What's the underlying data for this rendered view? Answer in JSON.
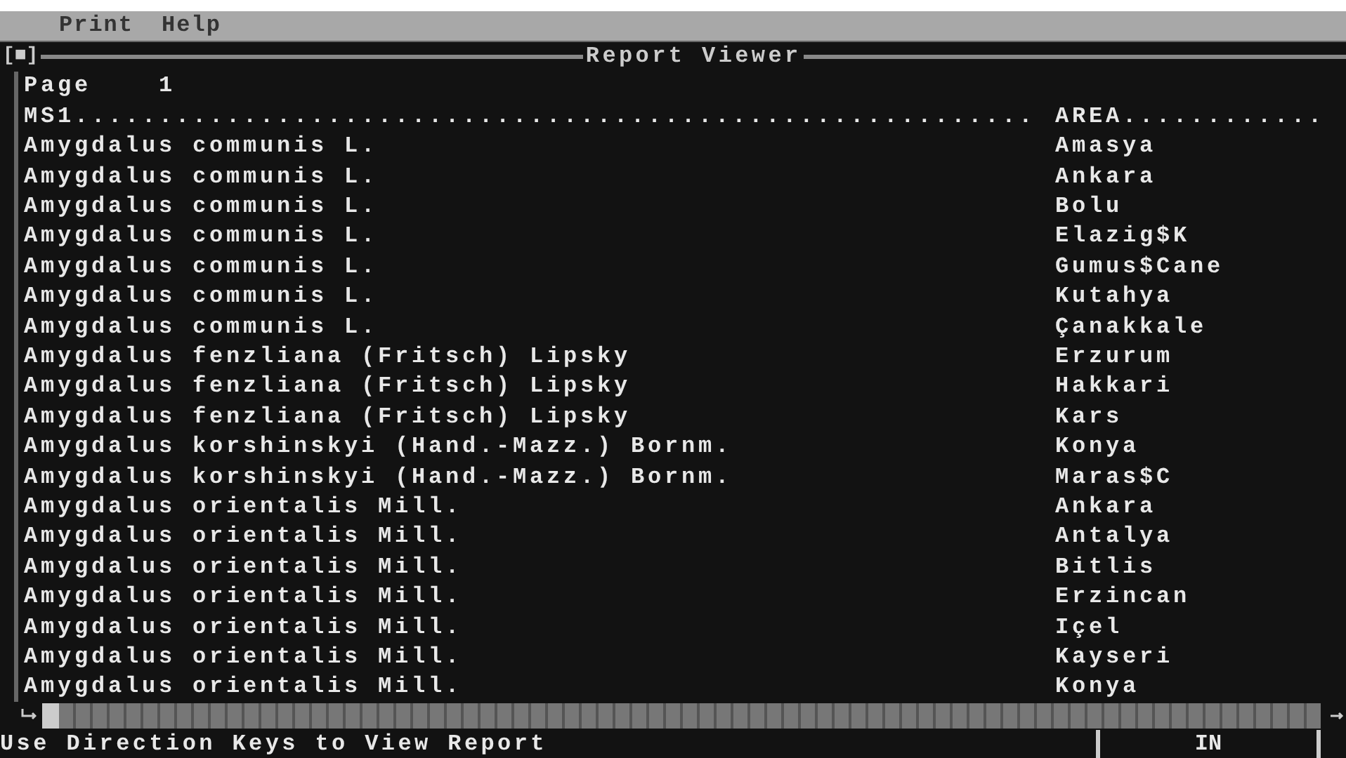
{
  "menu": [
    "Print",
    "Help"
  ],
  "window": {
    "close_glyph": "[■]",
    "title": "Report Viewer"
  },
  "page": {
    "label": "Page",
    "number": "1"
  },
  "header": {
    "column_1": "MS1.........................................................",
    "column_2": "AREA............"
  },
  "rows": [
    {
      "name": "Amygdalus communis L.",
      "area": "Amasya"
    },
    {
      "name": "Amygdalus communis L.",
      "area": "Ankara"
    },
    {
      "name": "Amygdalus communis L.",
      "area": "Bolu"
    },
    {
      "name": "Amygdalus communis L.",
      "area": "Elazig$K"
    },
    {
      "name": "Amygdalus communis L.",
      "area": "Gumus$Cane"
    },
    {
      "name": "Amygdalus communis L.",
      "area": "Kutahya"
    },
    {
      "name": "Amygdalus communis L.",
      "area": "Çanakkale"
    },
    {
      "name": "Amygdalus fenzliana (Fritsch) Lipsky",
      "area": "Erzurum"
    },
    {
      "name": "Amygdalus fenzliana (Fritsch) Lipsky",
      "area": "Hakkari"
    },
    {
      "name": "Amygdalus fenzliana (Fritsch) Lipsky",
      "area": "Kars"
    },
    {
      "name": "Amygdalus korshinskyi (Hand.-Mazz.) Bornm.",
      "area": "Konya"
    },
    {
      "name": "Amygdalus korshinskyi (Hand.-Mazz.) Bornm.",
      "area": "Maras$C"
    },
    {
      "name": "Amygdalus orientalis Mill.",
      "area": "Ankara"
    },
    {
      "name": "Amygdalus orientalis Mill.",
      "area": "Antalya"
    },
    {
      "name": "Amygdalus orientalis Mill.",
      "area": "Bitlis"
    },
    {
      "name": "Amygdalus orientalis Mill.",
      "area": "Erzincan"
    },
    {
      "name": "Amygdalus orientalis Mill.",
      "area": "Içel"
    },
    {
      "name": "Amygdalus orientalis Mill.",
      "area": "Kayseri"
    },
    {
      "name": "Amygdalus orientalis Mill.",
      "area": "Konya"
    }
  ],
  "status_bar": {
    "hint": "Use Direction Keys to View Report",
    "mode": "IN"
  }
}
